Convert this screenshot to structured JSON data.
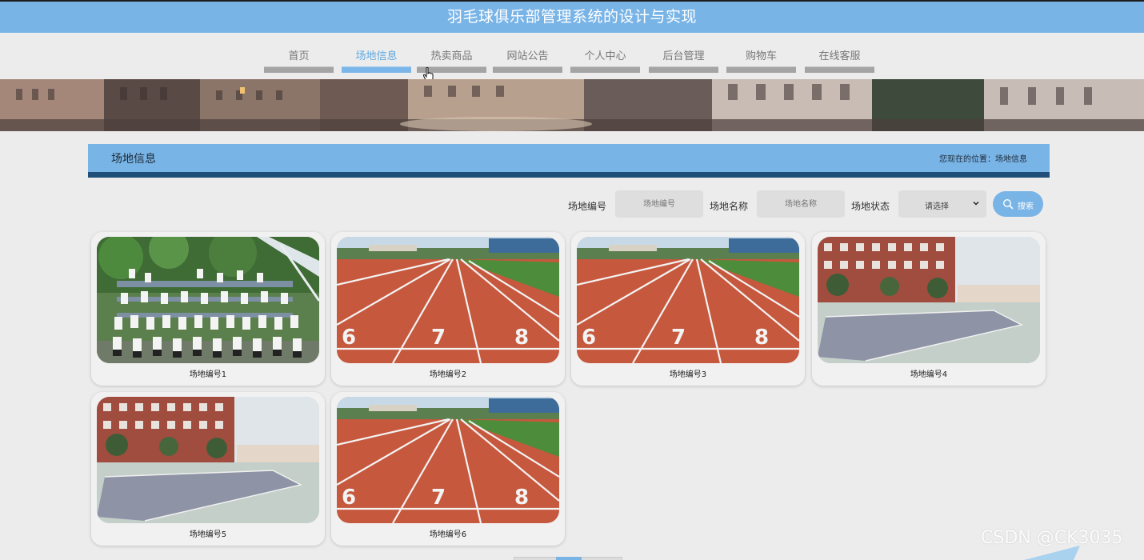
{
  "app": {
    "title": "羽毛球俱乐部管理系统的设计与实现"
  },
  "nav": {
    "items": [
      {
        "label": "首页",
        "active": false
      },
      {
        "label": "场地信息",
        "active": true
      },
      {
        "label": "热卖商品",
        "active": false
      },
      {
        "label": "网站公告",
        "active": false
      },
      {
        "label": "个人中心",
        "active": false
      },
      {
        "label": "后台管理",
        "active": false
      },
      {
        "label": "购物车",
        "active": false
      },
      {
        "label": "在线客服",
        "active": false
      }
    ]
  },
  "section": {
    "title": "场地信息",
    "breadcrumb": "您现在的位置：场地信息"
  },
  "filters": {
    "number_label": "场地编号",
    "number_placeholder": "场地编号",
    "name_label": "场地名称",
    "name_placeholder": "场地名称",
    "status_label": "场地状态",
    "status_value": "请选择",
    "search_label": "搜索"
  },
  "venues": [
    {
      "caption": "场地编号1",
      "image": "team-photo"
    },
    {
      "caption": "场地编号2",
      "image": "running-track"
    },
    {
      "caption": "场地编号3",
      "image": "running-track"
    },
    {
      "caption": "场地编号4",
      "image": "courtyard-court"
    },
    {
      "caption": "场地编号5",
      "image": "courtyard-court"
    },
    {
      "caption": "场地编号6",
      "image": "running-track"
    }
  ],
  "watermark": "CSDN @CK3035",
  "colors": {
    "accent": "#79b4e7",
    "accent_dark": "#1f4e79",
    "background": "#ececec"
  }
}
